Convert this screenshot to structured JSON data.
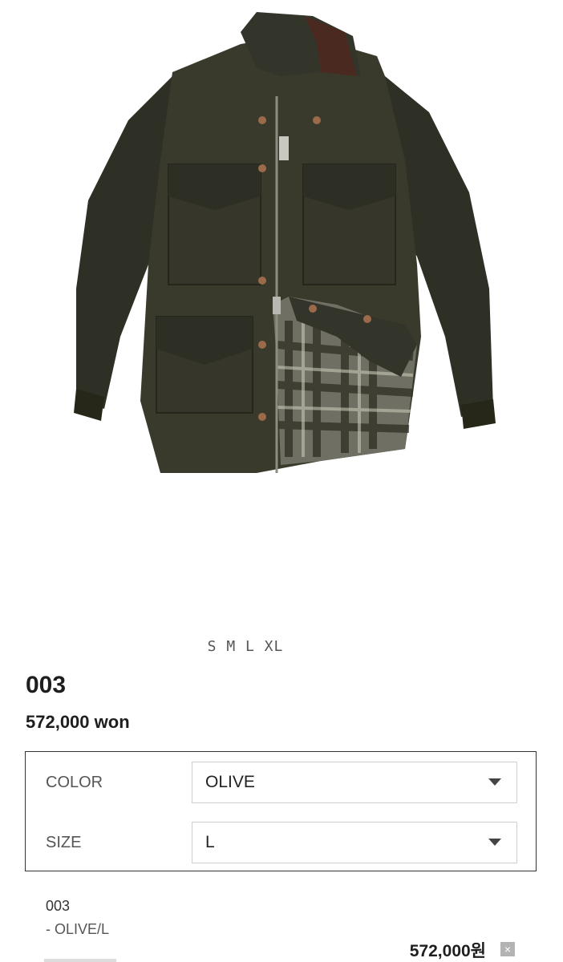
{
  "product": {
    "image_alt": "olive field jacket with plaid lining",
    "sizes_text": "S M L XL",
    "name": "003",
    "price": "572,000 won"
  },
  "options": {
    "color": {
      "label": "COLOR",
      "value": "OLIVE"
    },
    "size": {
      "label": "SIZE",
      "value": "L"
    }
  },
  "selected_item": {
    "name": "003",
    "option": "- OLIVE/L",
    "price": "572,000원",
    "remove_icon": "×"
  },
  "colors": {
    "jacket": "#3a3a2c",
    "collar": "#4a2a20",
    "lining_plaid": "#8a8a80"
  }
}
